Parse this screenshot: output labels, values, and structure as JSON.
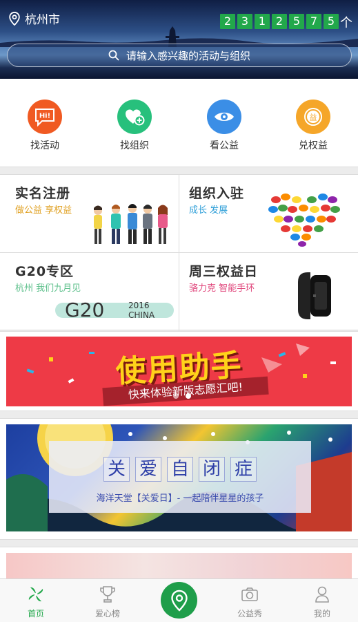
{
  "header": {
    "location": "杭州市",
    "counter_digits": [
      "2",
      "3",
      "1",
      "2",
      "5",
      "7",
      "5"
    ],
    "counter_unit": "个",
    "search_placeholder": "请输入感兴趣的活动与组织"
  },
  "quick_nav": [
    {
      "label": "找活动",
      "icon": "hi-bubble-icon",
      "color": "#f05a22",
      "badge": "Hi!"
    },
    {
      "label": "找组织",
      "icon": "heart-plus-icon",
      "color": "#27c07c"
    },
    {
      "label": "看公益",
      "icon": "eye-icon",
      "color": "#3b8ee6"
    },
    {
      "label": "兑权益",
      "icon": "benefit-coin-icon",
      "color": "#f5a629",
      "badge": "益"
    }
  ],
  "grid": [
    {
      "title": "实名注册",
      "subtitle": "做公益  享权益",
      "sub_color": "#e0a020"
    },
    {
      "title": "组织入驻",
      "subtitle": "成长  发展",
      "sub_color": "#2f9fd8"
    },
    {
      "title": "G20专区",
      "subtitle": "杭州 我们九月见",
      "sub_color": "#5bbf8a",
      "logo_text": "G20",
      "logo_year": "2016",
      "logo_country": "CHINA"
    },
    {
      "title": "周三权益日",
      "subtitle": "骆力克 智能手环",
      "sub_color": "#e0457b"
    }
  ],
  "banners": [
    {
      "title": "使用助手",
      "subtitle": "快来体验新版志愿汇吧!",
      "dots": 2,
      "active_dot": 1
    },
    {
      "chars": [
        "关",
        "爱",
        "自",
        "闭",
        "症"
      ],
      "subtitle": "海洋天堂【关爱日】- 一起陪伴星星的孩子"
    }
  ],
  "tabbar": [
    {
      "label": "首页",
      "icon": "pinwheel-icon",
      "active": true
    },
    {
      "label": "爱心榜",
      "icon": "trophy-icon",
      "active": false
    },
    {
      "label": "",
      "icon": "location-pin-icon",
      "active": false
    },
    {
      "label": "公益秀",
      "icon": "camera-icon",
      "active": false
    },
    {
      "label": "我的",
      "icon": "user-icon",
      "active": false
    }
  ],
  "colors": {
    "accent": "#22a84b",
    "counter_bg": "#22a84b"
  }
}
